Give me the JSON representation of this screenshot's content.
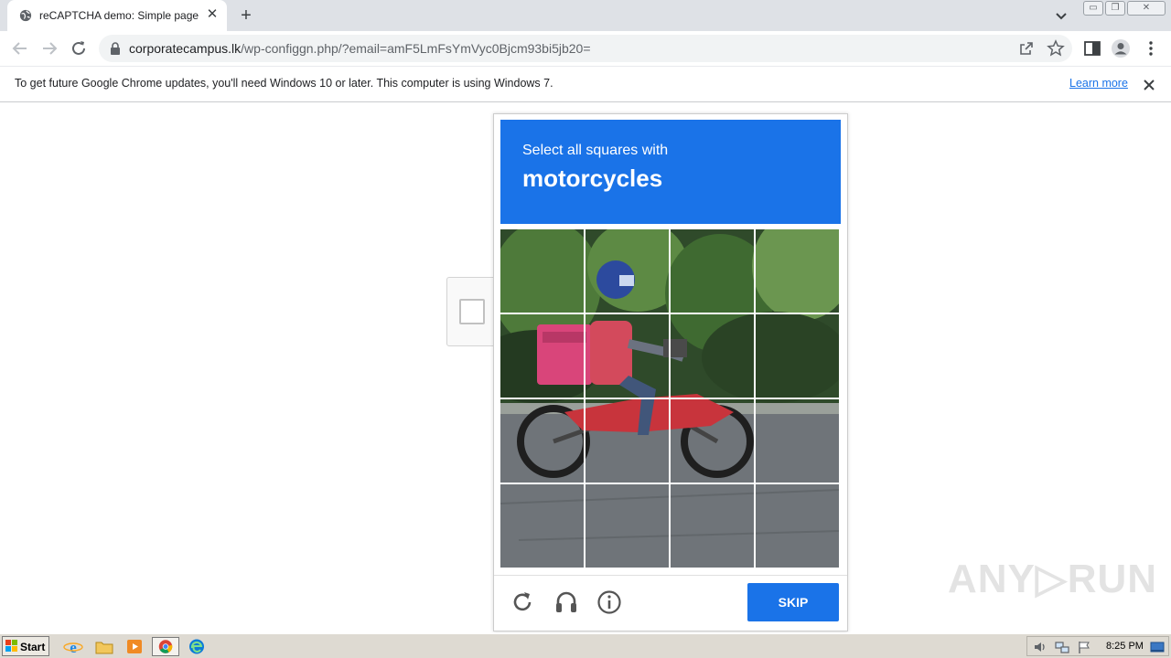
{
  "browser": {
    "tab_title": "reCAPTCHA demo: Simple page",
    "url_host": "corporatecampus.lk",
    "url_path": "/wp-configgn.php/?email=amF5LmFsYmVyc0Bjcm93bi5jb20=",
    "icons": [
      "globe-icon",
      "close-icon",
      "plus-icon",
      "chevron-down-icon",
      "back-icon",
      "forward-icon",
      "reload-icon",
      "lock-icon",
      "share-icon",
      "star-icon",
      "sidepanel-icon",
      "profile-icon",
      "menu-icon"
    ]
  },
  "infobar": {
    "message": "To get future Google Chrome updates, you'll need Windows 10 or later. This computer is using Windows 7.",
    "link": "Learn more"
  },
  "captcha": {
    "prompt_small": "Select all squares with",
    "prompt_big": "motorcycles",
    "skip_label": "SKIP",
    "accent_color": "#1a73e8",
    "grid_rows": 4,
    "grid_cols": 4,
    "footer_icons": [
      "reload-icon",
      "headphones-icon",
      "info-icon"
    ]
  },
  "watermark": {
    "text": "ANY▷RUN"
  },
  "taskbar": {
    "start_label": "Start",
    "clock": "8:25 PM",
    "apps": [
      "ie-icon",
      "folder-icon",
      "media-player-icon",
      "chrome-icon",
      "edge-icon"
    ]
  }
}
